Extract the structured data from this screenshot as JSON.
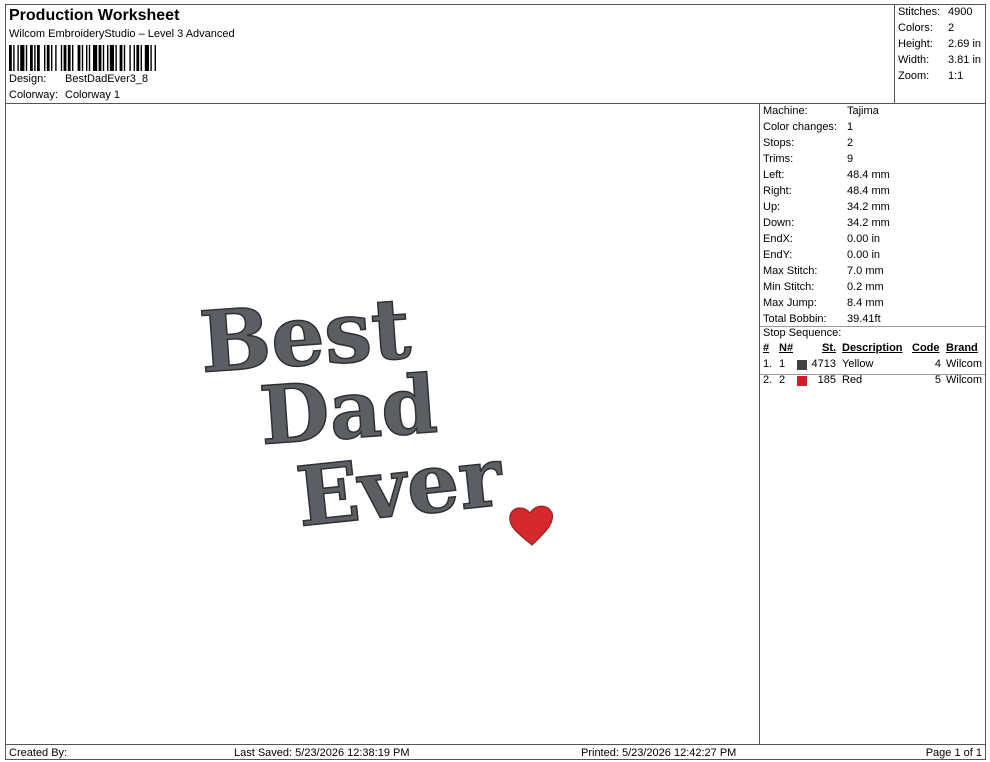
{
  "header": {
    "title": "Production Worksheet",
    "subtitle": "Wilcom EmbroideryStudio – Level 3 Advanced",
    "design_label": "Design:",
    "design_value": "BestDadEver3_8",
    "colorway_label": "Colorway:",
    "colorway_value": "Colorway 1"
  },
  "summary": [
    {
      "label": "Stitches:",
      "value": "4900"
    },
    {
      "label": "Colors:",
      "value": "2"
    },
    {
      "label": "Height:",
      "value": "2.69 in"
    },
    {
      "label": "Width:",
      "value": "3.81 in"
    },
    {
      "label": "Zoom:",
      "value": "1:1"
    }
  ],
  "properties": [
    {
      "label": "Machine:",
      "value": "Tajima"
    },
    {
      "label": "Color changes:",
      "value": "1"
    },
    {
      "label": "Stops:",
      "value": "2"
    },
    {
      "label": "Trims:",
      "value": "9"
    },
    {
      "label": "Left:",
      "value": "48.4 mm"
    },
    {
      "label": "Right:",
      "value": "48.4 mm"
    },
    {
      "label": "Up:",
      "value": "34.2 mm"
    },
    {
      "label": "Down:",
      "value": "34.2 mm"
    },
    {
      "label": "EndX:",
      "value": "0.00 in"
    },
    {
      "label": "EndY:",
      "value": "0.00 in"
    },
    {
      "label": "Max Stitch:",
      "value": "7.0 mm"
    },
    {
      "label": "Min Stitch:",
      "value": "0.2 mm"
    },
    {
      "label": "Max Jump:",
      "value": "8.4 mm"
    },
    {
      "label": "Total Bobbin:",
      "value": "39.41ft"
    }
  ],
  "stop_sequence": {
    "title": "Stop Sequence:",
    "columns": {
      "index": "#",
      "needle": "N#",
      "stitches": "St.",
      "description": "Description",
      "code": "Code",
      "brand": "Brand"
    },
    "rows": [
      {
        "index": "1.",
        "needle": "1",
        "color": "#3f4347",
        "stitches": "4713",
        "description": "Yellow",
        "code": "4",
        "brand": "Wilcom"
      },
      {
        "index": "2.",
        "needle": "2",
        "color": "#cc2026",
        "stitches": "185",
        "description": "Red",
        "code": "5",
        "brand": "Wilcom"
      }
    ]
  },
  "design": {
    "lines": [
      "Best",
      "Dad",
      "Ever"
    ],
    "text_color": "#5b5f63",
    "outline_color": "#2e3134",
    "heart_color": "#d42a2e"
  },
  "footer": {
    "created_by": "Created By:",
    "last_saved": "Last Saved: 5/23/2026 12:38:19 PM",
    "printed": "Printed: 5/23/2026 12:42:27 PM",
    "page": "Page 1 of 1"
  }
}
